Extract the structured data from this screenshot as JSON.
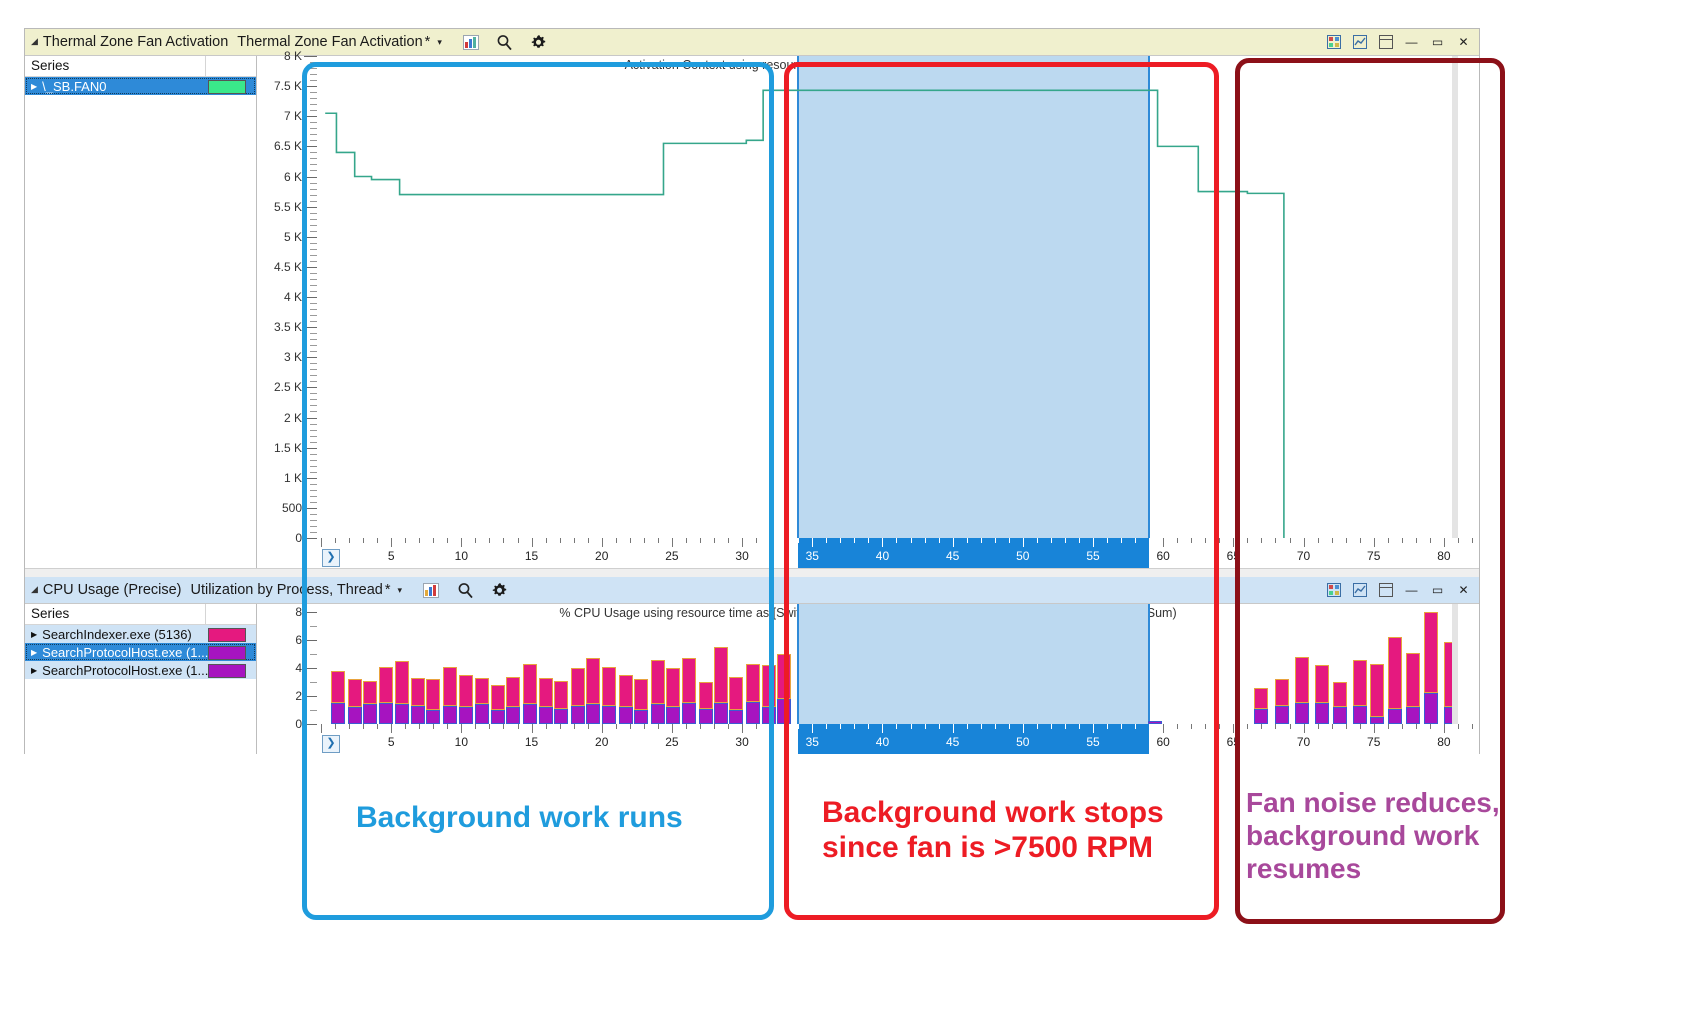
{
  "window": {
    "win_buttons": [
      "⊞",
      "⧉",
      "▭",
      "—",
      "▭",
      "✕"
    ]
  },
  "thermal_panel": {
    "collapse_icon": "collapse-triangle-icon",
    "title": "Thermal Zone Fan Activation",
    "preset": "Thermal Zone Fan Activation",
    "modified_marker": "*",
    "dropdown_caret": "▾",
    "icons": [
      "chart-icon",
      "search-icon",
      "gear-icon"
    ],
    "series_header": "Series",
    "series": [
      {
        "label": "\\_SB.FAN0",
        "color": "#3ae88a",
        "selected": true
      }
    ],
    "chart_title": "Activation Context using resource time as [Entry Time,Exit Time] (Aggregation: Average)"
  },
  "cpu_panel": {
    "collapse_icon": "collapse-triangle-icon",
    "title": "CPU Usage (Precise)",
    "preset": "Utilization by Process, Thread",
    "modified_marker": "*",
    "dropdown_caret": "▾",
    "icons": [
      "chart-icon",
      "search-icon",
      "gear-icon"
    ],
    "series_header": "Series",
    "series": [
      {
        "label": "SearchIndexer.exe (5136)",
        "color": "#e5197f",
        "selected": false,
        "lite": false
      },
      {
        "label": "SearchProtocolHost.exe (1...",
        "color": "#a614c0",
        "selected": true,
        "lite": false
      },
      {
        "label": "SearchProtocolHost.exe (1...",
        "color": "#a614c0",
        "selected": false,
        "lite": true
      }
    ],
    "chart_title": "% CPU Usage using resource time as [Switch-In Time,Switch-In Time+New Switch-In Time] (Aggregation: Sum)"
  },
  "annotations": [
    {
      "text": "Background work runs",
      "color": "#1f9cdd"
    },
    {
      "text": "Background work stops\nsince fan is >7500 RPM",
      "color": "#ed1c24"
    },
    {
      "text": "Fan noise reduces,\nbackground work\nresumes",
      "color": "#a8489b"
    }
  ],
  "colors": {
    "blue_callout": "#1f9cdd",
    "red_callout": "#ed1c24",
    "darkred_callout": "#8c1018",
    "purple_text": "#a8489b",
    "selection_fill": "#bcd9f0",
    "ruler_selection": "#1884d8"
  },
  "chart_data": [
    {
      "type": "line",
      "title": "Activation Context using resource time as [Entry Time,Exit Time] (Aggregation: Average)",
      "xlabel": "",
      "ylabel": "",
      "xlim": [
        0,
        82.5
      ],
      "ylim": [
        0,
        8000
      ],
      "grid": false,
      "legend": [
        "\\_SB.FAN0"
      ],
      "ytick_labels": [
        "8 K",
        "7.5 K",
        "7 K",
        "6.5 K",
        "6 K",
        "5.5 K",
        "5 K",
        "4.5 K",
        "4 K",
        "3.5 K",
        "3 K",
        "2.5 K",
        "2 K",
        "1.5 K",
        "1 K",
        "500",
        "0"
      ],
      "ytick_values": [
        8000,
        7500,
        7000,
        6500,
        6000,
        5500,
        5000,
        4500,
        4000,
        3500,
        3000,
        2500,
        2000,
        1500,
        1000,
        500,
        0
      ],
      "xtick_labels": [
        "5",
        "10",
        "15",
        "20",
        "25",
        "30",
        "35",
        "40",
        "45",
        "50",
        "55",
        "60",
        "65",
        "70",
        "75",
        "80"
      ],
      "xtick_values": [
        5,
        10,
        15,
        20,
        25,
        30,
        35,
        40,
        45,
        50,
        55,
        60,
        65,
        70,
        75,
        80
      ],
      "series": [
        {
          "name": "\\_SB.FAN0",
          "color": "#35a68b",
          "points": [
            [
              0.3,
              7050
            ],
            [
              1.1,
              7050
            ],
            [
              1.1,
              6400
            ],
            [
              2.4,
              6400
            ],
            [
              2.4,
              6000
            ],
            [
              3.6,
              6000
            ],
            [
              3.6,
              5950
            ],
            [
              5.6,
              5950
            ],
            [
              5.6,
              5700
            ],
            [
              24.4,
              5700
            ],
            [
              24.4,
              6550
            ],
            [
              30.3,
              6550
            ],
            [
              30.3,
              6600
            ],
            [
              31.5,
              6600
            ],
            [
              31.5,
              7430
            ],
            [
              59.6,
              7430
            ],
            [
              59.6,
              6500
            ],
            [
              62.5,
              6500
            ],
            [
              62.5,
              5750
            ],
            [
              66.0,
              5750
            ],
            [
              66.0,
              5720
            ],
            [
              68.6,
              5720
            ],
            [
              68.6,
              0
            ]
          ]
        }
      ],
      "selection_range": [
        34.0,
        59.0
      ]
    },
    {
      "type": "bar",
      "stacked": true,
      "title": "% CPU Usage using resource time as [Switch-In Time,Switch-In Time+New Switch-In Time] (Aggregation: Sum)",
      "xlabel": "",
      "ylabel": "",
      "xlim": [
        0,
        82.5
      ],
      "ylim": [
        0,
        8.6
      ],
      "ytick_labels": [
        "8",
        "6",
        "4",
        "2",
        "0"
      ],
      "ytick_values": [
        8,
        6,
        4,
        2,
        0
      ],
      "xtick_labels": [
        "5",
        "10",
        "15",
        "20",
        "25",
        "30",
        "35",
        "40",
        "45",
        "50",
        "55",
        "60",
        "65",
        "70",
        "75",
        "80"
      ],
      "xtick_values": [
        5,
        10,
        15,
        20,
        25,
        30,
        35,
        40,
        45,
        50,
        55,
        60,
        65,
        70,
        75,
        80
      ],
      "selection_range": [
        34.0,
        59.0
      ],
      "series_colors": {
        "SearchIndexer.exe": "#e5197f",
        "SearchProtocolHost.exe": "#a614c0"
      },
      "bars": [
        {
          "x": 1.2,
          "total": 3.8,
          "lower": 1.5
        },
        {
          "x": 2.4,
          "total": 3.2,
          "lower": 1.2
        },
        {
          "x": 3.5,
          "total": 3.1,
          "lower": 1.4
        },
        {
          "x": 4.6,
          "total": 4.1,
          "lower": 1.5
        },
        {
          "x": 5.8,
          "total": 4.5,
          "lower": 1.4
        },
        {
          "x": 6.9,
          "total": 3.3,
          "lower": 1.3
        },
        {
          "x": 8.0,
          "total": 3.2,
          "lower": 1.0
        },
        {
          "x": 9.2,
          "total": 4.1,
          "lower": 1.3
        },
        {
          "x": 10.3,
          "total": 3.5,
          "lower": 1.2
        },
        {
          "x": 11.5,
          "total": 3.3,
          "lower": 1.4
        },
        {
          "x": 12.6,
          "total": 2.8,
          "lower": 1.0
        },
        {
          "x": 13.7,
          "total": 3.4,
          "lower": 1.2
        },
        {
          "x": 14.9,
          "total": 4.3,
          "lower": 1.4
        },
        {
          "x": 16.0,
          "total": 3.3,
          "lower": 1.2
        },
        {
          "x": 17.1,
          "total": 3.1,
          "lower": 1.1
        },
        {
          "x": 18.3,
          "total": 4.0,
          "lower": 1.3
        },
        {
          "x": 19.4,
          "total": 4.7,
          "lower": 1.4
        },
        {
          "x": 20.5,
          "total": 4.1,
          "lower": 1.3
        },
        {
          "x": 21.7,
          "total": 3.5,
          "lower": 1.2
        },
        {
          "x": 22.8,
          "total": 3.2,
          "lower": 1.0
        },
        {
          "x": 24.0,
          "total": 4.6,
          "lower": 1.4
        },
        {
          "x": 25.1,
          "total": 4.0,
          "lower": 1.2
        },
        {
          "x": 26.2,
          "total": 4.7,
          "lower": 1.5
        },
        {
          "x": 27.4,
          "total": 3.0,
          "lower": 1.1
        },
        {
          "x": 28.5,
          "total": 5.5,
          "lower": 1.5
        },
        {
          "x": 29.6,
          "total": 3.4,
          "lower": 1.0
        },
        {
          "x": 30.8,
          "total": 4.3,
          "lower": 1.6
        },
        {
          "x": 31.9,
          "total": 4.2,
          "lower": 1.2
        },
        {
          "x": 33.0,
          "total": 5.0,
          "lower": 1.8
        },
        {
          "x": 59.4,
          "total": 0.25,
          "lower": 0.25
        },
        {
          "x": 67.0,
          "total": 2.6,
          "lower": 1.1
        },
        {
          "x": 68.5,
          "total": 3.2,
          "lower": 1.3
        },
        {
          "x": 69.9,
          "total": 4.8,
          "lower": 1.5
        },
        {
          "x": 71.3,
          "total": 4.2,
          "lower": 1.5
        },
        {
          "x": 72.6,
          "total": 3.0,
          "lower": 1.2
        },
        {
          "x": 74.0,
          "total": 4.6,
          "lower": 1.3
        },
        {
          "x": 75.2,
          "total": 4.3,
          "lower": 0.5
        },
        {
          "x": 76.5,
          "total": 6.2,
          "lower": 1.1
        },
        {
          "x": 77.8,
          "total": 5.1,
          "lower": 1.2
        },
        {
          "x": 79.1,
          "total": 8.0,
          "lower": 2.2
        },
        {
          "x": 80.5,
          "total": 5.9,
          "lower": 1.2
        }
      ]
    }
  ]
}
